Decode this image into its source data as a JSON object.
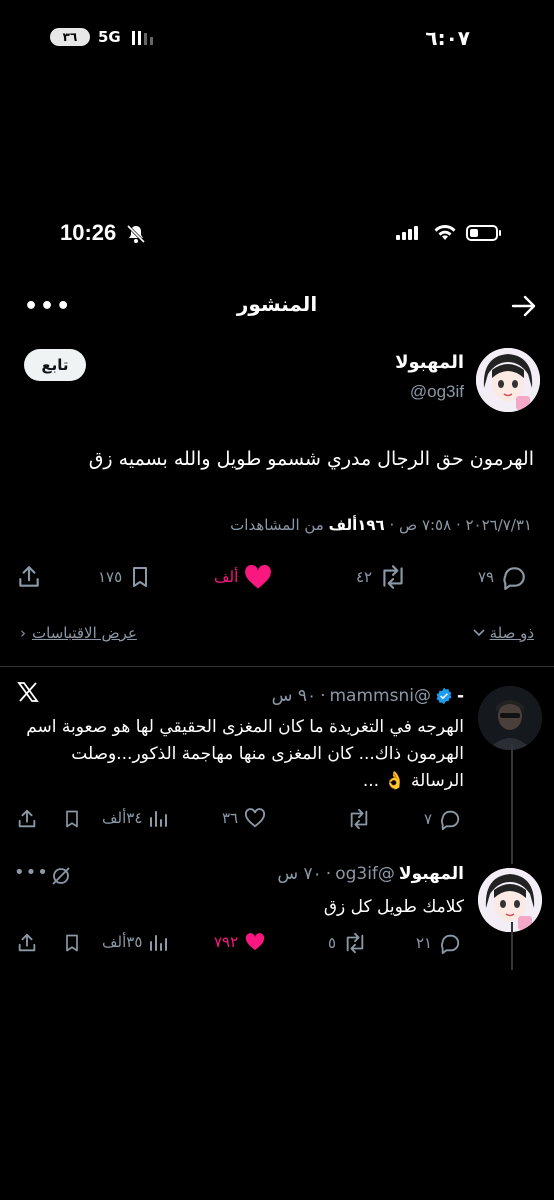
{
  "outer_status": {
    "time": "٦:٠٧",
    "battery": "٣٦",
    "network": "5G"
  },
  "ios_status": {
    "time": "10:26"
  },
  "header": {
    "title": "المنشور"
  },
  "post": {
    "author_name": "المهبولا",
    "author_handle": "@og3if",
    "follow_label": "تابع",
    "text": "الهرمون حق الرجال مدري شسمو طويل والله بسميه زق",
    "meta_date": "٢٠٢٦/٧/٣١ · ٧:٥٨ ص · ",
    "meta_views": "١٩٦ألف",
    "meta_views_label": " من المشاهدات",
    "replies": "٧٩",
    "reposts": "٤٢",
    "likes": "ألف",
    "bookmarks": "١٧٥"
  },
  "sub_row": {
    "relevance": "ذو صلة",
    "quotes": "عرض الاقتباسات"
  },
  "replies": [
    {
      "name": "-",
      "handle": "@mammsni",
      "time": "٩٠ س",
      "text": "الهرجه في التغريدة ما كان المغزى الحقيقي لها هو صعوبة اسم الهرمون ذاك... كان المغزى منها مهاجمة الذكور...وصلت الرسالة 👌 ...",
      "replies": "٧",
      "reposts": "",
      "likes": "٣٦",
      "views": "٣٤ألف"
    },
    {
      "name": "المهبولا",
      "handle": "@og3if",
      "time": "٧٠ س",
      "text": "كلامك طويل كل زق",
      "replies": "٢١",
      "reposts": "٥",
      "likes": "٧٩٢",
      "views": "٣٥ألف"
    }
  ],
  "colors": {
    "like": "#f91880",
    "muted": "#8b98a5",
    "verified": "#1d9bf0"
  }
}
